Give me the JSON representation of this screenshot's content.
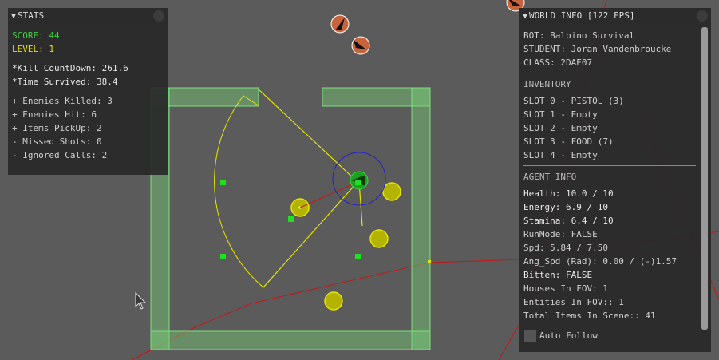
{
  "stats_panel": {
    "title": "STATS",
    "collapse_glyph": "▼",
    "score": "SCORE: 44",
    "level": "LEVEL: 1",
    "kill_countdown": "*Kill CountDown: 261.6",
    "time_survived": "*Time Survived: 38.4",
    "enemies_killed": "+ Enemies Killed: 3",
    "enemies_hit": "+ Enemies Hit: 6",
    "items_pickup": "+ Items PickUp: 2",
    "missed_shots": "- Missed Shots: 0",
    "ignored_calls": "- Ignored Calls: 2"
  },
  "world_info_panel": {
    "title": "WORLD INFO [122 FPS]",
    "collapse_glyph": "▼",
    "bot": "BOT: Balbino Survival",
    "student": "STUDENT: Joran Vandenbroucke",
    "class_name": "CLASS: 2DAE07",
    "inventory_header": "INVENTORY",
    "slots": [
      "SLOT 0 - PISTOL (3)",
      "SLOT 1 - Empty",
      "SLOT 2 - Empty",
      "SLOT 3 - FOOD (7)",
      "SLOT 4 - Empty"
    ],
    "agent_header": "AGENT INFO",
    "health": "Health: 10.0 / 10",
    "energy": "Energy: 6.9 / 10",
    "stamina": "Stamina: 6.4 / 10",
    "run_mode": "RunMode: FALSE",
    "speed": "Spd: 5.84 / 7.50",
    "ang_speed": "Ang_Spd (Rad): 0.00 / (-)1.57",
    "bitten": "Bitten: FALSE",
    "houses_in_fov": "Houses In FOV: 1",
    "entities_in_fov": "Entities In FOV:: 1",
    "total_items": "Total Items In Scene:: 41",
    "auto_follow_label": "Auto Follow",
    "auto_follow_checked": false
  },
  "colors": {
    "background": "#5b5b5b",
    "house": "#58b858",
    "fov_cone": "#e6e600",
    "agent": "#1f9e1f",
    "agent_range": "#2222cc",
    "item": "#c8c800",
    "enemy": "#c8643c",
    "path_line": "#c01818",
    "score_text": "#3ecf3e",
    "level_text": "#e6e000",
    "bright_text": "#e8e8e8",
    "dim_text": "#cfcfcf"
  }
}
